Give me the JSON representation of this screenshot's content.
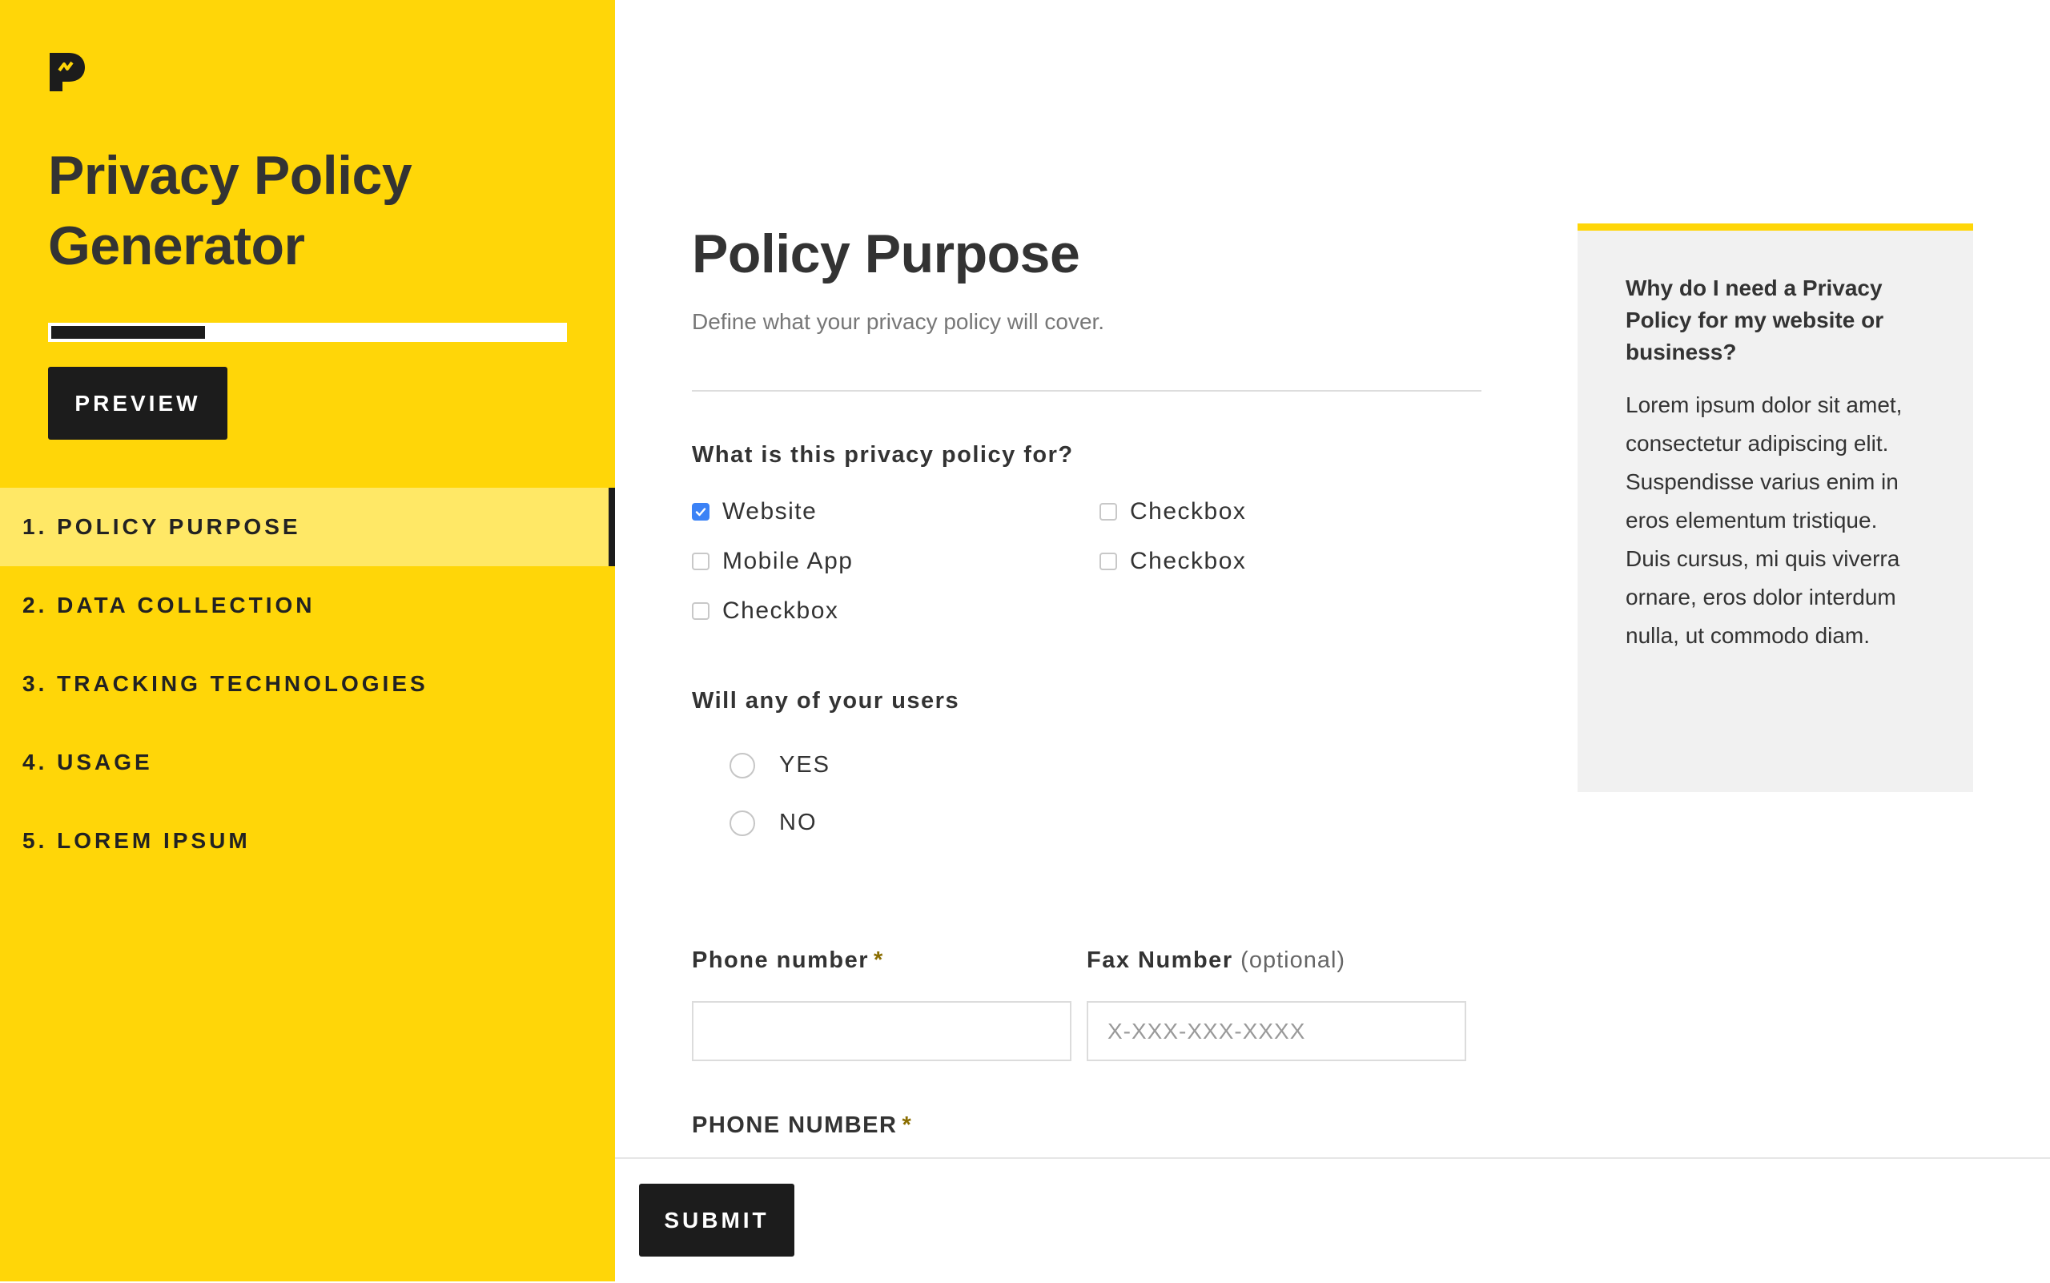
{
  "sidebar": {
    "logo_icon": "brand-p-logo-icon",
    "app_title": "Privacy Policy Generator",
    "progress": 0.3,
    "preview_label": "PREVIEW",
    "steps": [
      {
        "label": "1. POLICY PURPOSE",
        "active": true
      },
      {
        "label": "2. DATA COLLECTION",
        "active": false
      },
      {
        "label": "3. TRACKING TECHNOLOGIES",
        "active": false
      },
      {
        "label": "4. USAGE",
        "active": false
      },
      {
        "label": "5. LOREM IPSUM",
        "active": false
      }
    ]
  },
  "main": {
    "title": "Policy Purpose",
    "subtitle": "Define what your privacy policy will cover.",
    "question1": {
      "label": "What is this privacy policy for?",
      "options": [
        {
          "label": "Website",
          "checked": true
        },
        {
          "label": "Mobile App",
          "checked": false
        },
        {
          "label": "Checkbox",
          "checked": false
        },
        {
          "label": "Checkbox",
          "checked": false
        },
        {
          "label": "Checkbox",
          "checked": false
        }
      ]
    },
    "question2": {
      "label": "Will any of your users",
      "options": [
        {
          "label": "YES",
          "selected": false
        },
        {
          "label": "NO",
          "selected": false
        }
      ]
    },
    "phone_field": {
      "label": "Phone number",
      "required_mark": "*",
      "value": "",
      "placeholder": ""
    },
    "fax_field": {
      "label": "Fax Number",
      "optional_note": "(optional)",
      "value": "",
      "placeholder": "X-XXX-XXX-XXXX"
    },
    "phone_field_2": {
      "label": "PHONE NUMBER",
      "required_mark": "*"
    },
    "submit_label": "SUBMIT"
  },
  "info_card": {
    "title": "Why do I need a Privacy Policy for my website or business?",
    "body": "Lorem ipsum dolor sit amet, consectetur adipiscing elit. Suspendisse varius enim in eros elementum tristique. Duis cursus, mi quis viverra ornare, eros dolor interdum nulla, ut commodo diam.",
    "accent_color": "#ffd608"
  },
  "colors": {
    "brand_yellow": "#ffd608",
    "active_step": "#ffe866",
    "dark": "#1c1c1c",
    "checkbox_checked": "#3b82f6"
  }
}
